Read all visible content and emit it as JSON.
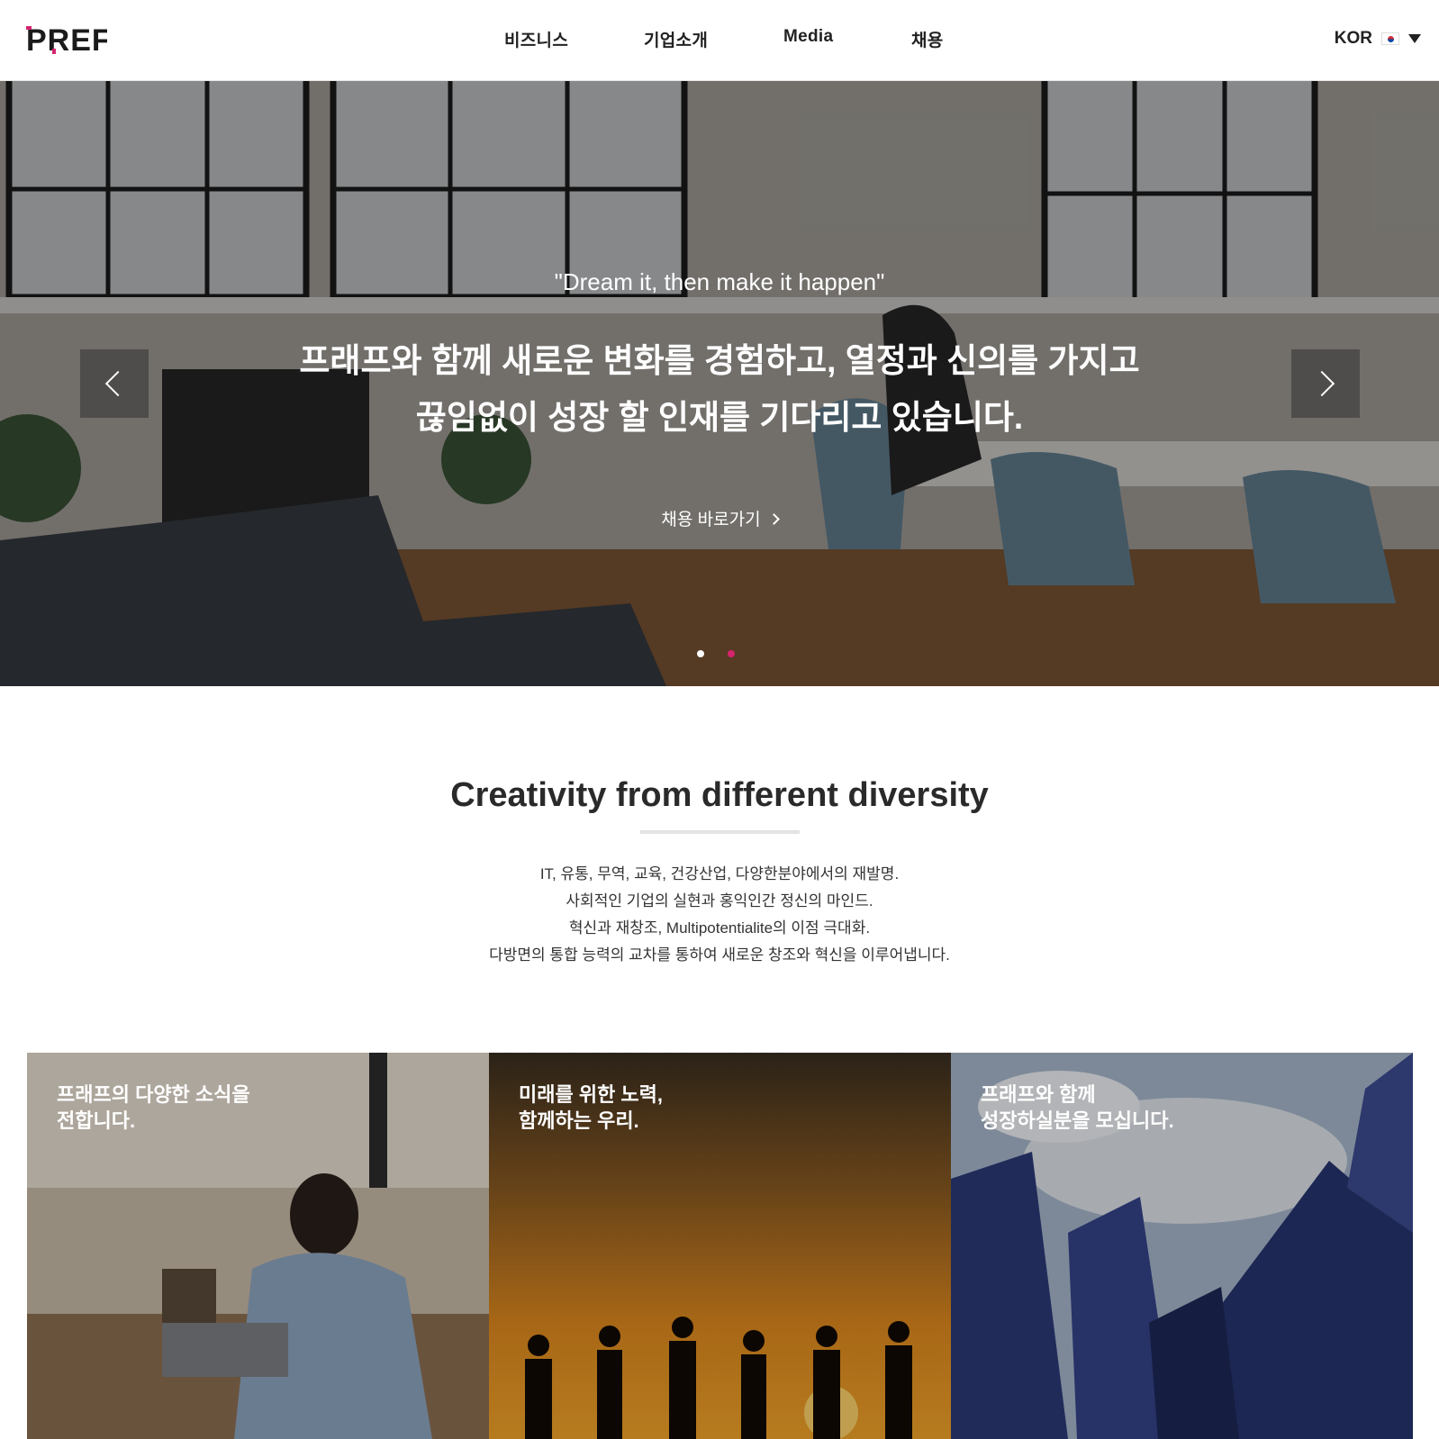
{
  "header": {
    "logo_text": "PREF",
    "nav": [
      "비즈니스",
      "기업소개",
      "Media",
      "채용"
    ],
    "lang": "KOR"
  },
  "hero": {
    "quote": "\"Dream it, then make it happen\"",
    "line1": "프래프와 함께 새로운 변화를 경험하고, 열정과 신의를 가지고",
    "line2": "끊임없이 성장 할 인재를 기다리고 있습니다.",
    "cta": "채용 바로가기",
    "slide_count": 2,
    "active_slide": 2,
    "accent_color": "#d6246e"
  },
  "intro": {
    "title": "Creativity from different diversity",
    "lines": [
      "IT, 유통, 무역, 교육, 건강산업, 다양한분야에서의 재발명.",
      "사회적인 기업의 실현과 홍익인간 정신의 마인드.",
      "혁신과 재창조, Multipotentialite의 이점 극대화.",
      "다방면의 통합 능력의 교차를 통하여 새로운 창조와 혁신을 이루어냅니다."
    ]
  },
  "cards": [
    {
      "line1": "프래프의 다양한 소식을",
      "line2": "전합니다."
    },
    {
      "line1": "미래를 위한 노력,",
      "line2": "함께하는 우리."
    },
    {
      "line1": "프래프와 함께",
      "line2": "성장하실분을 모십니다."
    }
  ]
}
